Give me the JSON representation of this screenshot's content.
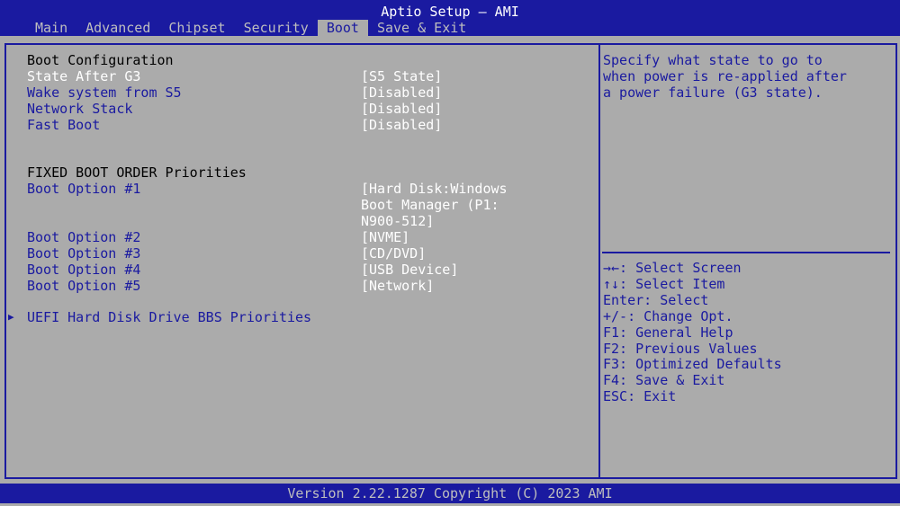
{
  "app": {
    "title": "Aptio Setup – AMI"
  },
  "tabs": [
    {
      "label": "Main"
    },
    {
      "label": "Advanced"
    },
    {
      "label": "Chipset"
    },
    {
      "label": "Security"
    },
    {
      "label": "Boot"
    },
    {
      "label": "Save & Exit"
    }
  ],
  "active_tab": "Boot",
  "boot": {
    "section_title": "Boot Configuration",
    "state_after_g3": {
      "label": "State After G3",
      "value": "[S5 State]"
    },
    "wake_from_s5": {
      "label": "Wake system from S5",
      "value": "[Disabled]"
    },
    "network_stack": {
      "label": "Network Stack",
      "value": "[Disabled]"
    },
    "fast_boot": {
      "label": "Fast Boot",
      "value": "[Disabled]"
    },
    "priorities_title": "FIXED BOOT ORDER Priorities",
    "options": [
      {
        "label": "Boot Option #1",
        "value": "[Hard Disk:Windows\nBoot Manager (P1:\nN900-512]"
      },
      {
        "label": "Boot Option #2",
        "value": "[NVME]"
      },
      {
        "label": "Boot Option #3",
        "value": "[CD/DVD]"
      },
      {
        "label": "Boot Option #4",
        "value": "[USB Device]"
      },
      {
        "label": "Boot Option #5",
        "value": "[Network]"
      }
    ],
    "submenu": {
      "label": "UEFI Hard Disk Drive BBS Priorities",
      "arrow_icon": "right-triangle"
    }
  },
  "help": {
    "text": "Specify what state to go to\nwhen power is re-applied after\na power failure (G3 state).",
    "keys": [
      "→←: Select Screen",
      "↑↓: Select Item",
      "Enter: Select",
      "+/-: Change Opt.",
      "F1: General Help",
      "F2: Previous Values",
      "F3: Optimized Defaults",
      "F4: Save & Exit",
      "ESC: Exit"
    ]
  },
  "footer": {
    "text": "Version 2.22.1287 Copyright (C) 2023 AMI"
  },
  "colors": {
    "background": "#ababab",
    "accent": "#1a1aa0",
    "selected_text": "#ffffff",
    "heading_text": "#000000"
  }
}
